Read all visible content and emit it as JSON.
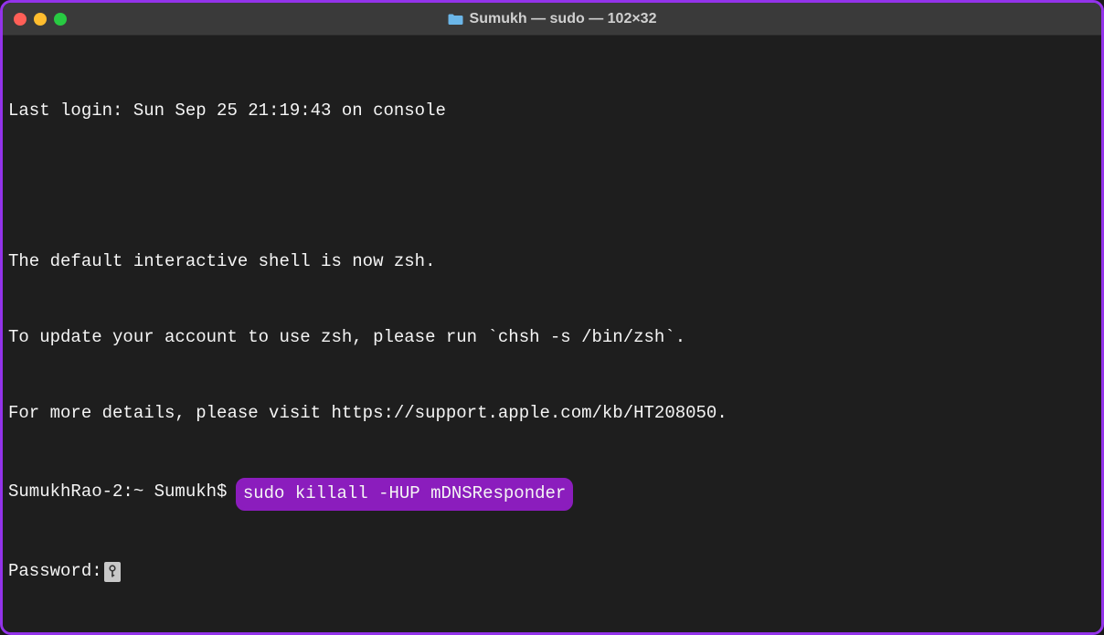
{
  "window": {
    "title": "Sumukh — sudo — 102×32"
  },
  "terminal": {
    "last_login": "Last login: Sun Sep 25 21:19:43 on console",
    "shell_notice_1": "The default interactive shell is now zsh.",
    "shell_notice_2": "To update your account to use zsh, please run `chsh -s /bin/zsh`.",
    "shell_notice_3": "For more details, please visit https://support.apple.com/kb/HT208050.",
    "prompt_prefix": "SumukhRao-2:~ Sumukh$ ",
    "command": "sudo killall -HUP mDNSResponder",
    "password_label": "Password:"
  }
}
